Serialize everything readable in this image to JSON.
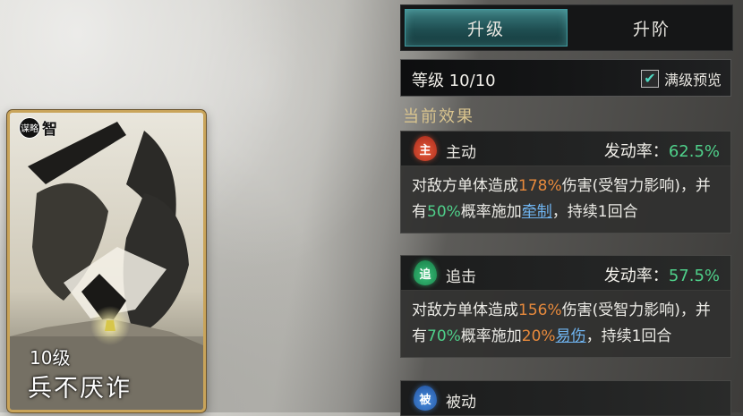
{
  "card": {
    "badge_icon": "谋略",
    "badge_text": "智",
    "level": "10级",
    "name": "兵不厌诈"
  },
  "tabs": [
    {
      "label": "升级",
      "active": true
    },
    {
      "label": "升阶",
      "active": false
    }
  ],
  "level_row": {
    "text": "等级 10/10",
    "preview_label": "满级预览",
    "preview_checked": true
  },
  "section_title": "当前效果",
  "effects": [
    {
      "icon_char": "主",
      "icon_name": "active-skill-icon",
      "type": "主动",
      "rate_label": "发动率：",
      "rate_value": "62.5%",
      "desc": {
        "p1": "对敌方单体造成",
        "v1": "178%",
        "p2": "伤害(受智力影响)，并有",
        "v2": "50%",
        "p3": "概率施加",
        "link": "牵制",
        "p4": "，持续1回合"
      }
    },
    {
      "icon_char": "追",
      "icon_name": "pursuit-skill-icon",
      "type": "追击",
      "rate_label": "发动率：",
      "rate_value": "57.5%",
      "desc": {
        "p1": "对敌方单体造成",
        "v1": "156%",
        "p2": "伤害(受智力影响)，并有",
        "v2": "70%",
        "p3": "概率施加",
        "v3": "20%",
        "link": "易伤",
        "p4": "，持续1回合"
      }
    },
    {
      "icon_char": "被",
      "icon_name": "passive-skill-icon",
      "type": "被动"
    }
  ],
  "colors": {
    "accent_teal": "#3e9aa0",
    "rate_green": "#4fd08a",
    "damage_orange": "#e88a3c",
    "link_blue": "#6fb4f0",
    "section_gold": "#d9c48e"
  }
}
